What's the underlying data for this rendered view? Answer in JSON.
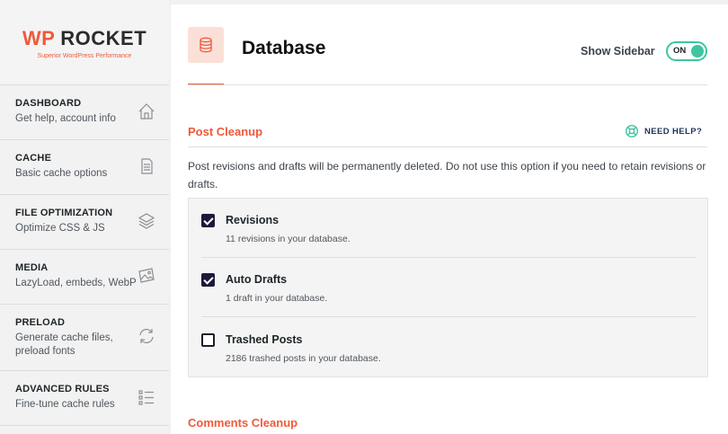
{
  "brand": {
    "wp": "WP",
    "rocket": "ROCKET",
    "tagline": "Superior WordPress Performance",
    "accent": "#ef5a3a"
  },
  "nav": [
    {
      "title": "DASHBOARD",
      "sub": "Get help, account info",
      "icon": "home-icon"
    },
    {
      "title": "CACHE",
      "sub": "Basic cache options",
      "icon": "document-icon"
    },
    {
      "title": "FILE OPTIMIZATION",
      "sub": "Optimize CSS & JS",
      "icon": "layers-icon"
    },
    {
      "title": "MEDIA",
      "sub": "LazyLoad, embeds, WebP",
      "icon": "image-icon"
    },
    {
      "title": "PRELOAD",
      "sub": "Generate cache files, preload fonts",
      "icon": "refresh-icon"
    },
    {
      "title": "ADVANCED RULES",
      "sub": "Fine-tune cache rules",
      "icon": "list-icon"
    }
  ],
  "header": {
    "title": "Database",
    "icon": "database-icon",
    "show_sidebar_label": "Show Sidebar",
    "toggle_state": "ON",
    "toggle_color": "#3ec5a0"
  },
  "post_cleanup": {
    "title": "Post Cleanup",
    "help_label": "NEED HELP?",
    "description": "Post revisions and drafts will be permanently deleted. Do not use this option if you need to retain revisions or drafts.",
    "options": [
      {
        "label": "Revisions",
        "sub": "11 revisions in your database.",
        "checked": true
      },
      {
        "label": "Auto Drafts",
        "sub": "1 draft in your database.",
        "checked": true
      },
      {
        "label": "Trashed Posts",
        "sub": "2186 trashed posts in your database.",
        "checked": false
      }
    ]
  },
  "comments_cleanup": {
    "title": "Comments Cleanup"
  }
}
